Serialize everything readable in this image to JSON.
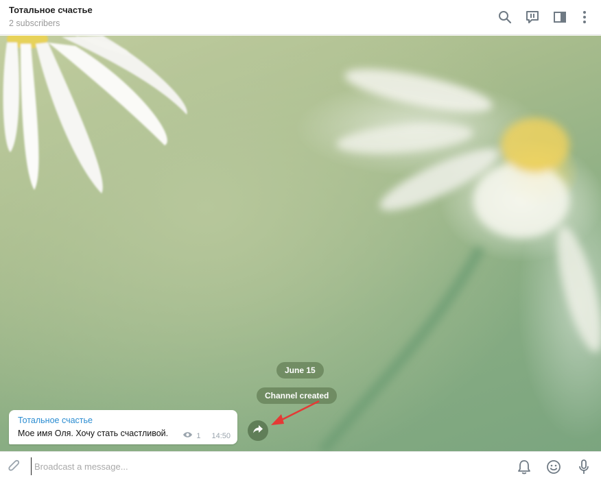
{
  "header": {
    "title": "Тотальное счастье",
    "subtitle": "2 subscribers",
    "icons": [
      "search-icon",
      "discussion-icon",
      "sidebar-toggle-icon",
      "more-icon"
    ]
  },
  "chat": {
    "date_pill": "June 15",
    "service_pill": "Channel created",
    "message": {
      "author": "Тотальное счастье",
      "text": "Мое имя Оля. Хочу стать счастливой.",
      "views": "1",
      "time": "14:50"
    },
    "annotation_color": "#e53935"
  },
  "composer": {
    "placeholder": "Broadcast a message...",
    "icons": [
      "attach-icon",
      "bell-icon",
      "emoji-icon",
      "microphone-icon"
    ]
  },
  "colors": {
    "accent": "#2a8cd1",
    "icon": "#6f7a84"
  }
}
